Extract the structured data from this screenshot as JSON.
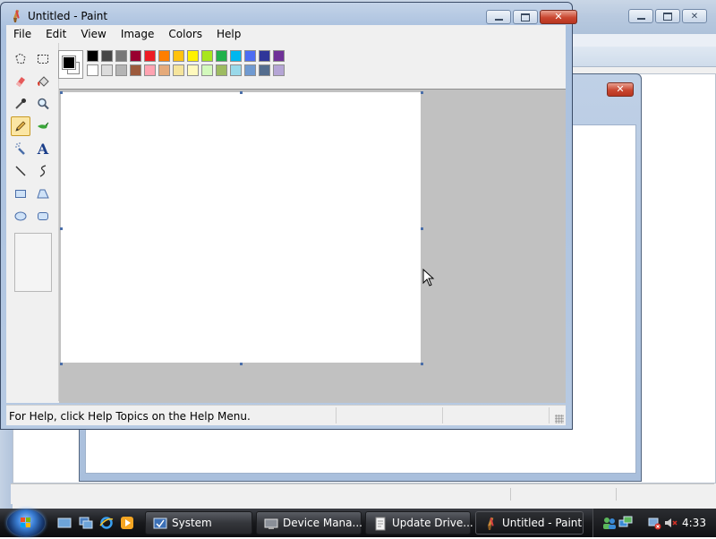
{
  "paint": {
    "title": "Untitled - Paint",
    "menu": [
      "File",
      "Edit",
      "View",
      "Image",
      "Colors",
      "Help"
    ],
    "tools": [
      {
        "name": "free-select-icon"
      },
      {
        "name": "select-icon"
      },
      {
        "name": "eraser-icon"
      },
      {
        "name": "fill-icon"
      },
      {
        "name": "pick-color-icon"
      },
      {
        "name": "magnifier-icon"
      },
      {
        "name": "pencil-icon",
        "active": true
      },
      {
        "name": "brush-icon"
      },
      {
        "name": "airbrush-icon"
      },
      {
        "name": "text-icon"
      },
      {
        "name": "line-icon"
      },
      {
        "name": "curve-icon"
      },
      {
        "name": "rectangle-icon"
      },
      {
        "name": "polygon-icon"
      },
      {
        "name": "ellipse-icon"
      },
      {
        "name": "rounded-rect-icon"
      }
    ],
    "text_tool_label": "A",
    "palette": {
      "foreground": "#000000",
      "background": "#ffffff",
      "top_row": [
        "#000000",
        "#464646",
        "#787878",
        "#990030",
        "#ed1c24",
        "#ff7e00",
        "#ffc20e",
        "#fff200",
        "#a8e61d",
        "#22b14c",
        "#00b7ef",
        "#4d6df3",
        "#2f3699",
        "#6f3198"
      ],
      "bottom_row": [
        "#ffffff",
        "#dcdcdc",
        "#b4b4b4",
        "#9c5a3c",
        "#ffa3b1",
        "#e5aa7a",
        "#f5e49c",
        "#fff9bd",
        "#d3f9bc",
        "#9dbb61",
        "#99d9ea",
        "#709ad1",
        "#546d8e",
        "#b5a5d5"
      ]
    },
    "status": "For Help, click Help Topics on the Help Menu."
  },
  "taskbar": {
    "tasks": [
      {
        "label": "System",
        "icon": "system-icon"
      },
      {
        "label": "Device Mana...",
        "icon": "device-manager-icon"
      },
      {
        "label": "Update Drive...",
        "icon": "document-icon"
      },
      {
        "label": "Untitled - Paint",
        "icon": "paint-icon",
        "active": true
      }
    ],
    "clock": "4:33"
  }
}
